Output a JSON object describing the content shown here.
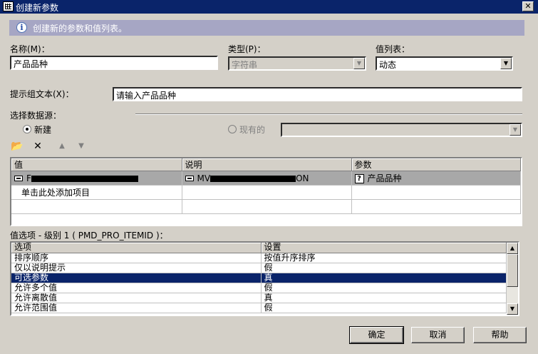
{
  "window": {
    "title": "创建新参数",
    "close_glyph": "✕"
  },
  "info": {
    "text": "创建新的参数和值列表。",
    "icon": "info-icon"
  },
  "name": {
    "label": "名称(M)：",
    "value": "产品品种"
  },
  "type": {
    "label": "类型(P)：",
    "value": "字符串"
  },
  "lov": {
    "label": "值列表：",
    "value": "动态"
  },
  "prompt": {
    "label": "提示组文本(X)：",
    "value": "请输入产品品种"
  },
  "datasource": {
    "label": "选择数据源：",
    "new_label": "新建",
    "existing_label": "现有的"
  },
  "toolbar": {
    "icons": [
      "open-folder-icon",
      "delete-icon",
      "move-up-icon",
      "move-down-icon"
    ]
  },
  "values_table": {
    "headers": [
      "值",
      "说明",
      "参数"
    ],
    "row1": {
      "value_prefix": "F",
      "desc_prefix": "MV",
      "desc_suffix": "ON",
      "param": "产品品种"
    },
    "add_item": "单击此处添加项目"
  },
  "options": {
    "label": "值选项 - 级别 1 ( PMD_PRO_ITEMID )：",
    "headers": [
      "选项",
      "设置"
    ],
    "rows": [
      {
        "option": "排序顺序",
        "setting": "按值升序排序"
      },
      {
        "option": "仅以说明提示",
        "setting": "假"
      },
      {
        "option": "可选参数",
        "setting": "真"
      },
      {
        "option": "允许多个值",
        "setting": "假"
      },
      {
        "option": "允许离散值",
        "setting": "真"
      },
      {
        "option": "允许范围值",
        "setting": "假"
      }
    ]
  },
  "buttons": {
    "ok": "确定",
    "cancel": "取消",
    "help": "帮助"
  },
  "colors": {
    "titlebar": "#0a246a",
    "face": "#d4d0c8",
    "banner": "#a6a6c4",
    "selection": "#0a246a"
  }
}
